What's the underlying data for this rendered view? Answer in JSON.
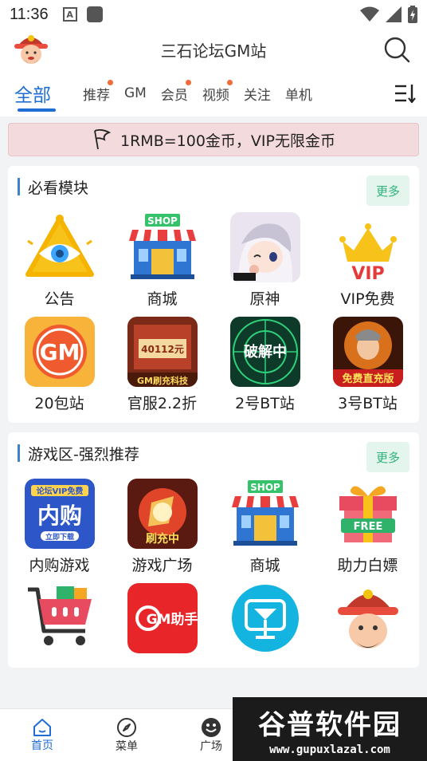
{
  "status": {
    "time": "11:36",
    "a_icon_letter": "A"
  },
  "header": {
    "title": "三石论坛GM站"
  },
  "tabs": [
    {
      "label": "全部",
      "active": true,
      "dot": false
    },
    {
      "label": "推荐",
      "active": false,
      "dot": true
    },
    {
      "label": "GM",
      "active": false,
      "dot": false
    },
    {
      "label": "会员",
      "active": false,
      "dot": true
    },
    {
      "label": "视频",
      "active": false,
      "dot": true
    },
    {
      "label": "关注",
      "active": false,
      "dot": false
    },
    {
      "label": "单机",
      "active": false,
      "dot": false
    }
  ],
  "notice": {
    "text": "1RMB=100金币，VIP无限金币",
    "icon": "flag-icon"
  },
  "section1": {
    "title": "必看模块",
    "more": "更多",
    "items": [
      {
        "label": "公告",
        "icon": "eye-pyramid-icon"
      },
      {
        "label": "商城",
        "icon": "shop-icon"
      },
      {
        "label": "原神",
        "icon": "genshin-icon"
      },
      {
        "label": "VIP免费",
        "icon": "vip-crown-icon"
      },
      {
        "label": "20包站",
        "icon": "gm-badge-icon"
      },
      {
        "label": "官服2.2折",
        "icon": "official-server-icon"
      },
      {
        "label": "2号BT站",
        "icon": "crack-icon"
      },
      {
        "label": "3号BT站",
        "icon": "free-recharge-icon"
      }
    ],
    "icon_text": {
      "shop": "SHOP",
      "vip": "VIP",
      "gm": "GM",
      "recharge_amount": "40112元",
      "gm_tech": "GM刷充科技",
      "crack": "破解中",
      "free": "免费直充版"
    }
  },
  "section2": {
    "title": "游戏区-强烈推荐",
    "more": "更多",
    "items": [
      {
        "label": "内购游戏",
        "icon": "in-app-purchase-icon"
      },
      {
        "label": "游戏广场",
        "icon": "game-square-icon"
      },
      {
        "label": "商城",
        "icon": "shop-icon"
      },
      {
        "label": "助力白嫖",
        "icon": "gift-free-icon"
      },
      {
        "label": "",
        "icon": "cart-icon"
      },
      {
        "label": "",
        "icon": "gm-helper-icon"
      },
      {
        "label": "",
        "icon": "cocktail-icon"
      },
      {
        "label": "",
        "icon": "god-of-wealth-icon"
      }
    ],
    "icon_text": {
      "vip_small": "论坛VIP免费",
      "neigou": "内购",
      "download": "立即下载",
      "shua": "刷充中",
      "shop": "SHOP",
      "free": "FREE",
      "gm_helper": "GM助手"
    }
  },
  "bottom_nav": [
    {
      "label": "首页",
      "icon": "home-icon",
      "active": true
    },
    {
      "label": "菜单",
      "icon": "compass-icon",
      "active": false
    },
    {
      "label": "广场",
      "icon": "smile-icon",
      "active": false
    }
  ],
  "watermark": {
    "cn": "谷普软件园",
    "en": "www.gupuxlazal.com"
  },
  "colors": {
    "accent": "#1f6ed4",
    "more_bg": "#e3f5ec",
    "more_text": "#2fb37a",
    "notice_bg": "#f3dadd",
    "dot": "#f26b3a"
  }
}
